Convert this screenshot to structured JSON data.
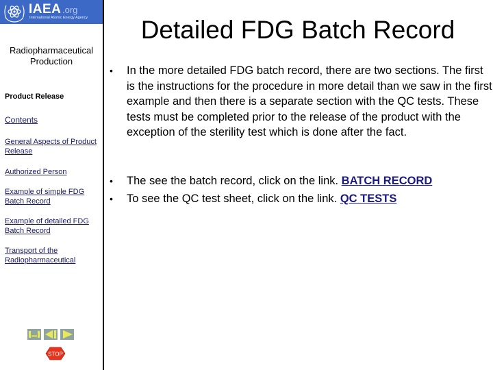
{
  "logo": {
    "name": "IAEA",
    "suffix": ".org",
    "agency": "International Atomic Energy Agency",
    "color": "#3c68c6"
  },
  "sidebar": {
    "section_title": "Radiopharmaceutical Production",
    "heading": "Product Release",
    "links": [
      {
        "label": "Contents"
      },
      {
        "label": "General Aspects of Product Release"
      },
      {
        "label": "Authorized Person"
      },
      {
        "label": "Example of simple FDG Batch Record"
      },
      {
        "label": "Example of detailed FDG Batch Record"
      },
      {
        "label": "Transport of the Radiopharmaceutical"
      }
    ],
    "controls": {
      "home_icon": "home-icon",
      "back_icon": "back-icon",
      "forward_icon": "forward-icon",
      "stop_label": "STOP"
    }
  },
  "main": {
    "title": "Detailed FDG Batch Record",
    "bullets": [
      {
        "text": "In the more detailed FDG batch record, there are two sections. The first is the instructions for the procedure in more detail than we saw in the first example and then there is a separate section with the QC tests.  These tests must be completed prior to the release of the product with the exception of the sterility test which is done after the fact."
      },
      {
        "text": "The see the batch record, click on the link. ",
        "link": "BATCH RECORD"
      },
      {
        "text": "To see the QC test sheet, click on the link. ",
        "link": "QC TESTS"
      }
    ],
    "bullet_char": "•"
  }
}
